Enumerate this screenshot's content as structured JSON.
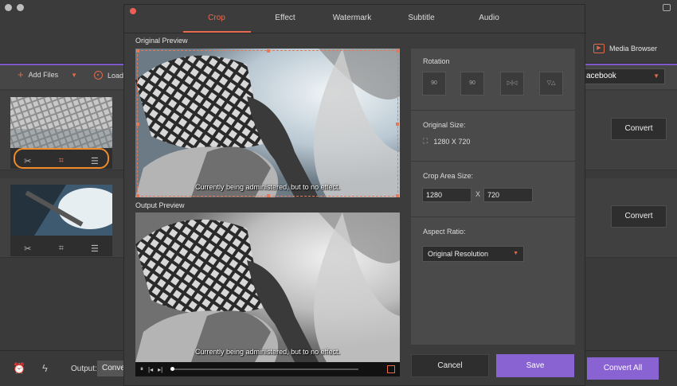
{
  "app": {
    "media_browser_label": "Media Browser",
    "toolbar": {
      "add_files_label": "Add Files",
      "load_label": "Load"
    },
    "profile_select": "acebook",
    "files": [
      {
        "convert_label": "Convert"
      },
      {
        "convert_label": "Convert"
      }
    ],
    "bottom": {
      "output_label": "Output:",
      "output_value": "Conve",
      "convert_all_label": "Convert All"
    }
  },
  "dialog": {
    "tabs": [
      {
        "label": "Crop",
        "active": true
      },
      {
        "label": "Effect",
        "active": false
      },
      {
        "label": "Watermark",
        "active": false
      },
      {
        "label": "Subtitle",
        "active": false
      },
      {
        "label": "Audio",
        "active": false
      }
    ],
    "original_preview_label": "Original Preview",
    "output_preview_label": "Output Preview",
    "subtitle_text": "Currently being administered, but to no effect.",
    "rotation": {
      "label": "Rotation",
      "buttons": [
        {
          "icon": "rotate-left-90-icon",
          "text": "90"
        },
        {
          "icon": "rotate-right-90-icon",
          "text": "90"
        },
        {
          "icon": "flip-horizontal-icon",
          "text": "▷|◁"
        },
        {
          "icon": "flip-vertical-icon",
          "text": "▽△"
        }
      ]
    },
    "original_size": {
      "label": "Original Size:",
      "value": "1280 X 720"
    },
    "crop_area": {
      "label": "Crop Area Size:",
      "width": "1280",
      "separator": "X",
      "height": "720"
    },
    "aspect_ratio": {
      "label": "Aspect Ratio:",
      "value": "Original Resolution"
    },
    "cancel_label": "Cancel",
    "save_label": "Save",
    "playback_progress": 0
  },
  "colors": {
    "accent": "#e76b50",
    "primary": "#8a63d2",
    "highlight": "#f08a2a"
  }
}
